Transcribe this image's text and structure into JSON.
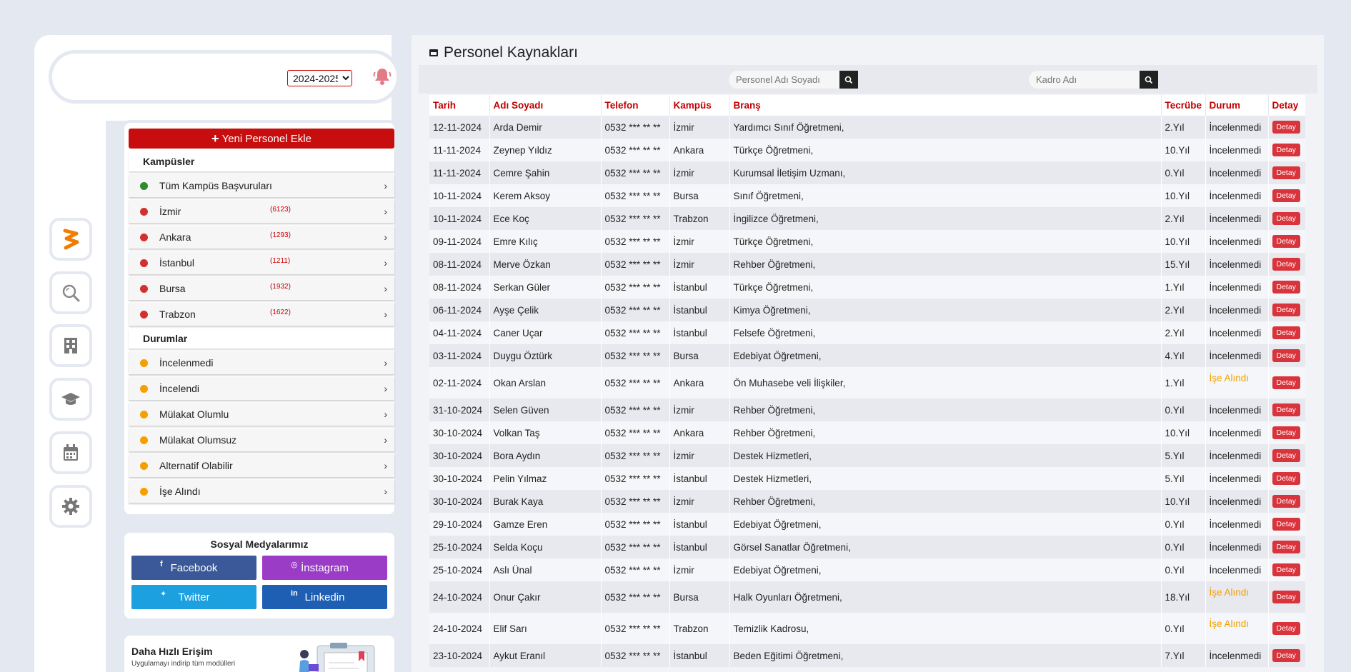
{
  "header": {
    "year_selected": "2024-2025"
  },
  "rail": {
    "icons": [
      "brand-logo-icon",
      "search-icon",
      "building-icon",
      "graduation-cap-icon",
      "calendar-icon",
      "gear-icon"
    ]
  },
  "menu": {
    "add_label": "Yeni Personel Ekle",
    "campuses_title": "Kampüsler",
    "campuses": [
      {
        "label": "Tüm Kampüs Başvuruları",
        "count": "",
        "color": "#2e8b2e"
      },
      {
        "label": "İzmir",
        "count": "(6123)",
        "color": "#d32f2f"
      },
      {
        "label": "Ankara",
        "count": "(1293)",
        "color": "#d32f2f"
      },
      {
        "label": "İstanbul",
        "count": "(1211)",
        "color": "#d32f2f"
      },
      {
        "label": "Bursa",
        "count": "(1932)",
        "color": "#d32f2f"
      },
      {
        "label": "Trabzon",
        "count": "(1622)",
        "color": "#d32f2f"
      }
    ],
    "status_title": "Durumlar",
    "statuses": [
      {
        "label": "İncelenmedi",
        "color": "#f5a000"
      },
      {
        "label": "İncelendi",
        "color": "#f5a000"
      },
      {
        "label": "Mülakat Olumlu",
        "color": "#f5a000"
      },
      {
        "label": "Mülakat Olumsuz",
        "color": "#f5a000"
      },
      {
        "label": "Alternatif Olabilir",
        "color": "#f5a000"
      },
      {
        "label": "İşe Alındı",
        "color": "#f5a000"
      }
    ]
  },
  "social": {
    "title": "Sosyal Medyalarımız",
    "facebook": "Facebook",
    "instagram": "İnstagram",
    "twitter": "Twitter",
    "linkedin": "Linkedin"
  },
  "quick": {
    "title": "Daha Hızlı Erişim",
    "subtitle": "Uygulamayı indirip tüm modülleri"
  },
  "main": {
    "title": "Personel Kaynakları",
    "search_name_placeholder": "Personel Adı Soyadı",
    "search_staff_placeholder": "Kadro Adı"
  },
  "table": {
    "headers": [
      "Tarih",
      "Adı Soyadı",
      "Telefon",
      "Kampüs",
      "Branş",
      "Tecrübe",
      "Durum",
      "Detay"
    ],
    "detail_label": "Detay",
    "rows": [
      {
        "date": "12-11-2024",
        "name": "Arda Demir",
        "phone": "0532 *** ** **",
        "campus": "İzmir",
        "branch": "Yardımcı Sınıf Öğretmeni,",
        "exp": "2.Yıl",
        "status": "İncelenmedi"
      },
      {
        "date": "11-11-2024",
        "name": "Zeynep Yıldız",
        "phone": "0532 *** ** **",
        "campus": "Ankara",
        "branch": "Türkçe Öğretmeni,",
        "exp": "10.Yıl",
        "status": "İncelenmedi"
      },
      {
        "date": "11-11-2024",
        "name": "Cemre Şahin",
        "phone": "0532 *** ** **",
        "campus": "İzmir",
        "branch": "Kurumsal İletişim Uzmanı,",
        "exp": "0.Yıl",
        "status": "İncelenmedi"
      },
      {
        "date": "10-11-2024",
        "name": "Kerem Aksoy",
        "phone": "0532 *** ** **",
        "campus": "Bursa",
        "branch": "Sınıf Öğretmeni,",
        "exp": "10.Yıl",
        "status": "İncelenmedi"
      },
      {
        "date": "10-11-2024",
        "name": "Ece Koç",
        "phone": "0532 *** ** **",
        "campus": "Trabzon",
        "branch": "İngilizce Öğretmeni,",
        "exp": "2.Yıl",
        "status": "İncelenmedi"
      },
      {
        "date": "09-11-2024",
        "name": "Emre Kılıç",
        "phone": "0532 *** ** **",
        "campus": "İzmir",
        "branch": "Türkçe Öğretmeni,",
        "exp": "10.Yıl",
        "status": "İncelenmedi"
      },
      {
        "date": "08-11-2024",
        "name": "Merve Özkan",
        "phone": "0532 *** ** **",
        "campus": "İzmir",
        "branch": "Rehber Öğretmeni,",
        "exp": "15.Yıl",
        "status": "İncelenmedi"
      },
      {
        "date": "08-11-2024",
        "name": "Serkan Güler",
        "phone": "0532 *** ** **",
        "campus": "İstanbul",
        "branch": "Türkçe Öğretmeni,",
        "exp": "1.Yıl",
        "status": "İncelenmedi"
      },
      {
        "date": "06-11-2024",
        "name": "Ayşe Çelik",
        "phone": "0532 *** ** **",
        "campus": "İstanbul",
        "branch": "Kimya Öğretmeni,",
        "exp": "2.Yıl",
        "status": "İncelenmedi"
      },
      {
        "date": "04-11-2024",
        "name": "Caner Uçar",
        "phone": "0532 *** ** **",
        "campus": "İstanbul",
        "branch": "Felsefe Öğretmeni,",
        "exp": "2.Yıl",
        "status": "İncelenmedi"
      },
      {
        "date": "03-11-2024",
        "name": "Duygu Öztürk",
        "phone": "0532 *** ** **",
        "campus": "Bursa",
        "branch": "Edebiyat Öğretmeni,",
        "exp": "4.Yıl",
        "status": "İncelenmedi"
      },
      {
        "date": "02-11-2024",
        "name": "Okan Arslan",
        "phone": "0532 *** ** **",
        "campus": "Ankara",
        "branch": "Ön Muhasebe veli İlişkiler,",
        "exp": "1.Yıl",
        "status": "İşe Alındı"
      },
      {
        "date": "31-10-2024",
        "name": "Selen Güven",
        "phone": "0532 *** ** **",
        "campus": "İzmir",
        "branch": "Rehber Öğretmeni,",
        "exp": "0.Yıl",
        "status": "İncelenmedi"
      },
      {
        "date": "30-10-2024",
        "name": "Volkan Taş",
        "phone": "0532 *** ** **",
        "campus": "Ankara",
        "branch": "Rehber Öğretmeni,",
        "exp": "10.Yıl",
        "status": "İncelenmedi"
      },
      {
        "date": "30-10-2024",
        "name": "Bora Aydın",
        "phone": "0532 *** ** **",
        "campus": "İzmir",
        "branch": "Destek Hizmetleri,",
        "exp": "5.Yıl",
        "status": "İncelenmedi"
      },
      {
        "date": "30-10-2024",
        "name": "Pelin Yılmaz",
        "phone": "0532 *** ** **",
        "campus": "İstanbul",
        "branch": "Destek Hizmetleri,",
        "exp": "5.Yıl",
        "status": "İncelenmedi"
      },
      {
        "date": "30-10-2024",
        "name": "Burak Kaya",
        "phone": "0532 *** ** **",
        "campus": "İzmir",
        "branch": "Rehber Öğretmeni,",
        "exp": "10.Yıl",
        "status": "İncelenmedi"
      },
      {
        "date": "29-10-2024",
        "name": "Gamze Eren",
        "phone": "0532 *** ** **",
        "campus": "İstanbul",
        "branch": "Edebiyat Öğretmeni,",
        "exp": "0.Yıl",
        "status": "İncelenmedi"
      },
      {
        "date": "25-10-2024",
        "name": "Selda Koçu",
        "phone": "0532 *** ** **",
        "campus": "İstanbul",
        "branch": "Görsel Sanatlar Öğretmeni,",
        "exp": "0.Yıl",
        "status": "İncelenmedi"
      },
      {
        "date": "25-10-2024",
        "name": "Aslı Ünal",
        "phone": "0532 *** ** **",
        "campus": "İzmir",
        "branch": "Edebiyat Öğretmeni,",
        "exp": "0.Yıl",
        "status": "İncelenmedi"
      },
      {
        "date": "24-10-2024",
        "name": "Onur Çakır",
        "phone": "0532 *** ** **",
        "campus": "Bursa",
        "branch": "Halk Oyunları Öğretmeni,",
        "exp": "18.Yıl",
        "status": "İşe Alındı"
      },
      {
        "date": "24-10-2024",
        "name": "Elif Sarı",
        "phone": "0532 *** ** **",
        "campus": "Trabzon",
        "branch": "Temizlik Kadrosu,",
        "exp": "0.Yıl",
        "status": "İşe Alındı"
      },
      {
        "date": "23-10-2024",
        "name": "Aykut Eranıl",
        "phone": "0532 *** ** **",
        "campus": "İstanbul",
        "branch": "Beden Eğitimi Öğretmeni,",
        "exp": "7.Yıl",
        "status": "İncelenmedi"
      }
    ]
  },
  "colors": {
    "accent_red": "#c70d0d",
    "header_red": "#c20000",
    "detail_btn": "#d9333b",
    "hired": "#f0a000",
    "brand_orange": "#f07c00"
  }
}
